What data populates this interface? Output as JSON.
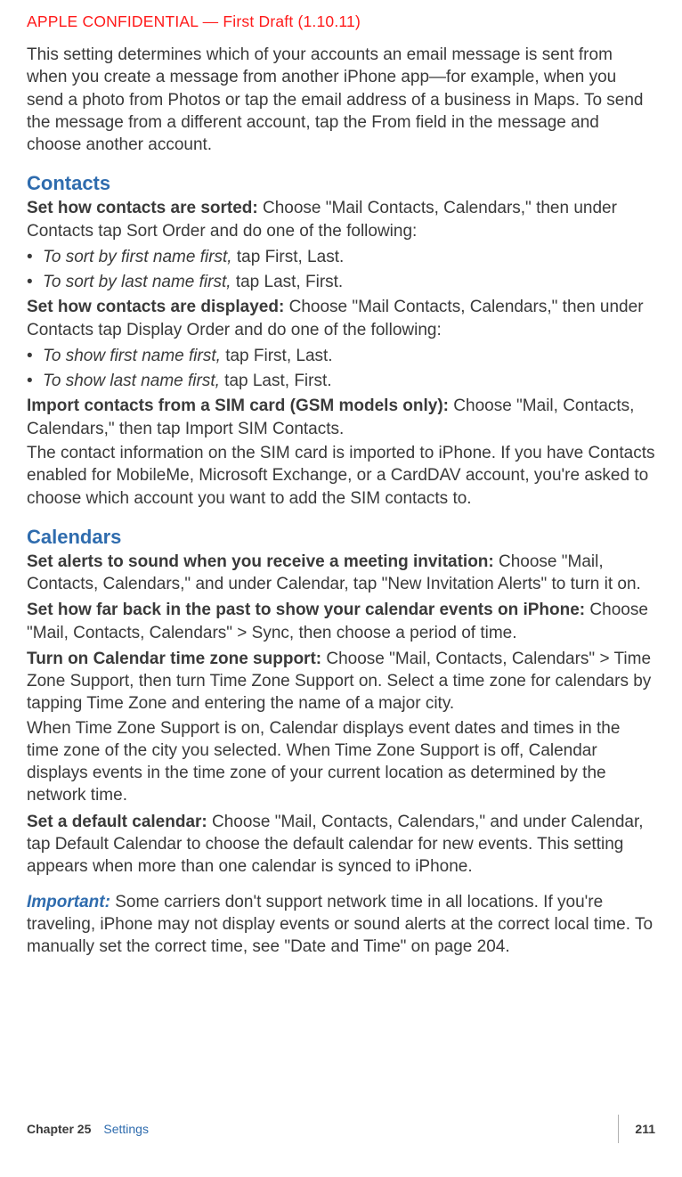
{
  "header": {
    "confidential": "APPLE CONFIDENTIAL  —  First Draft (1.10.11)"
  },
  "intro": "This setting determines which of your accounts an email message is sent from when you create a message from another iPhone app—for example, when you send a photo from Photos or tap the email address of a business in Maps. To send the message from a different account, tap the From field in the message and choose another account.",
  "contacts": {
    "heading": "Contacts",
    "sort_label": "Set how contacts are sorted:",
    "sort_body": "  Choose \"Mail Contacts, Calendars,\" then under Contacts tap Sort Order and do one of the following:",
    "sort_b1_italic": "To sort by first name first,",
    "sort_b1_rest": " tap First, Last.",
    "sort_b2_italic": "To sort by last name first,",
    "sort_b2_rest": " tap Last, First.",
    "display_label": "Set how contacts are displayed:",
    "display_body": "  Choose \"Mail Contacts, Calendars,\" then under Contacts tap Display Order and do one of the following:",
    "display_b1_italic": "To show first name first,",
    "display_b1_rest": " tap First, Last.",
    "display_b2_italic": "To show last name first,",
    "display_b2_rest": " tap Last, First.",
    "import_label": "Import contacts from a SIM card (GSM models only):",
    "import_body": "  Choose \"Mail, Contacts, Calendars,\" then tap Import SIM Contacts.",
    "import_note": "The contact information on the SIM card is imported to iPhone. If you have Contacts enabled for MobileMe, Microsoft Exchange, or a CardDAV account, you're asked to choose which account you want to add the SIM contacts to."
  },
  "calendars": {
    "heading": "Calendars",
    "alerts_label": "Set alerts to sound when you receive a meeting invitation:",
    "alerts_body": "  Choose \"Mail, Contacts, Calendars,\" and under Calendar, tap \"New Invitation Alerts\" to turn it on.",
    "past_label": "Set how far back in the past to show your calendar events on iPhone:",
    "past_body": "  Choose \"Mail, Contacts, Calendars\" > Sync, then choose a period of time.",
    "tz_label": "Turn on Calendar time zone support:",
    "tz_body": "  Choose \"Mail, Contacts, Calendars\" > Time Zone Support, then turn Time Zone Support on. Select a time zone for calendars by tapping Time Zone and entering the name of a major city.",
    "tz_note": "When Time Zone Support is on, Calendar displays event dates and times in the time zone of the city you selected. When Time Zone Support is off, Calendar displays events in the time zone of your current location as determined by the network time.",
    "default_label": "Set a default calendar:",
    "default_body": "  Choose \"Mail, Contacts, Calendars,\" and under Calendar, tap Default Calendar to choose the default calendar for new events. This setting appears when more than one calendar is synced to iPhone.",
    "important_label": "Important:",
    "important_body": "  Some carriers don't support network time in all locations. If you're traveling, iPhone may not display events or sound alerts at the correct local time. To manually set the correct time, see \"Date and Time\" on page 204."
  },
  "footer": {
    "chapter_label": "Chapter 25",
    "chapter_name": "Settings",
    "page": "211"
  }
}
